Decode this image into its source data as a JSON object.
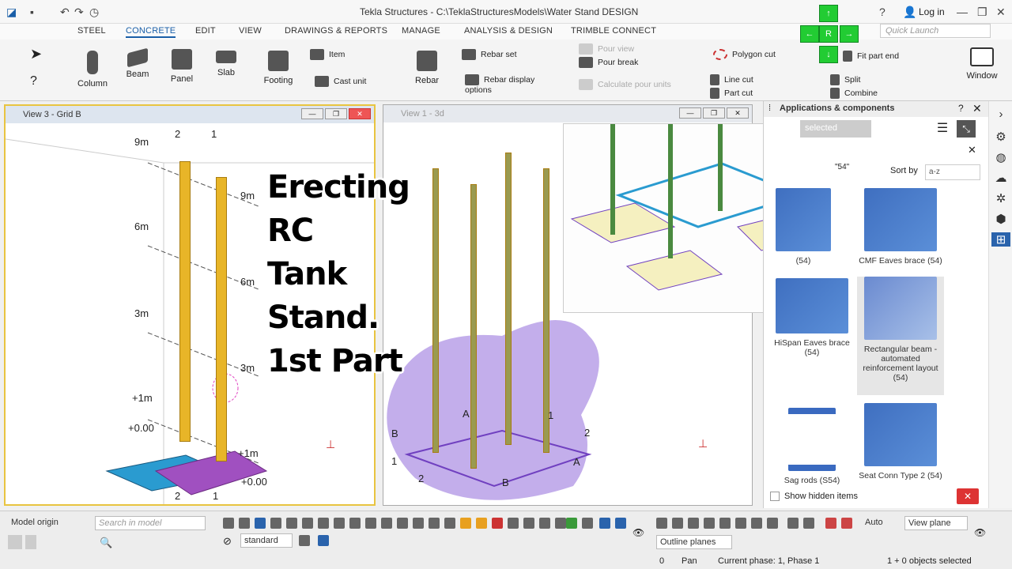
{
  "window": {
    "title": "Tekla Structures - C:\\TeklaStructuresModels\\Water Stand DESIGN",
    "login": "Log in",
    "quick_launch": "Quick Launch"
  },
  "tabs": [
    "STEEL",
    "CONCRETE",
    "EDIT",
    "VIEW",
    "DRAWINGS & REPORTS",
    "MANAGE",
    "ANALYSIS & DESIGN",
    "TRIMBLE CONNECT"
  ],
  "ribbon": {
    "column": "Column",
    "beam": "Beam",
    "panel": "Panel",
    "slab": "Slab",
    "footing": "Footing",
    "item": "Item",
    "cast_unit": "Cast unit",
    "rebar": "Rebar",
    "rebar_set": "Rebar set",
    "rebar_display": "Rebar display options",
    "pour_view": "Pour view",
    "pour_break": "Pour break",
    "calc_pour": "Calculate pour units",
    "polygon_cut": "Polygon cut",
    "line_cut": "Line cut",
    "part_cut": "Part cut",
    "fit_part_end": "Fit part end",
    "split": "Split",
    "combine": "Combine",
    "window": "Window"
  },
  "nav": {
    "up": "↑",
    "left": "←",
    "center": "R",
    "right": "→",
    "down": "↓"
  },
  "view3": {
    "title": "View 3 - Grid B",
    "labels": [
      "9m",
      "6m",
      "3m",
      "+1m",
      "+0.00",
      "9m",
      "6m",
      "3m",
      "+1m",
      "+0.00"
    ],
    "grid": [
      "2",
      "1",
      "2",
      "1"
    ]
  },
  "view1": {
    "title": "View 1 - 3d",
    "grid": [
      "A",
      "B",
      "1",
      "2",
      "B",
      "A",
      "1",
      "2"
    ]
  },
  "overlay": [
    "Erecting",
    "RC",
    "Tank",
    "Stand.",
    "1st Part"
  ],
  "apps": {
    "title": "Applications & components",
    "selected": "selected",
    "search_count": "\"54\"",
    "sort_label": "Sort by",
    "sort_value": "a-z",
    "items": [
      {
        "name": "(54)"
      },
      {
        "name": "CMF Eaves brace (54)"
      },
      {
        "name": "HiSpan Eaves brace (54)"
      },
      {
        "name": "Rectangular beam - automated reinforcement layout (54)"
      },
      {
        "name": "Sag rods (S54)"
      },
      {
        "name": "Seat Conn Type 2 (54)"
      }
    ],
    "show_hidden": "Show hidden items"
  },
  "bottom": {
    "model_origin": "Model origin",
    "search_placeholder": "Search in model",
    "standard": "standard",
    "auto": "Auto",
    "view_plane": "View plane",
    "outline_planes": "Outline planes"
  },
  "status": {
    "count": "0",
    "mode": "Pan",
    "phase": "Current phase: 1, Phase 1",
    "selected": "1 + 0 objects selected"
  }
}
